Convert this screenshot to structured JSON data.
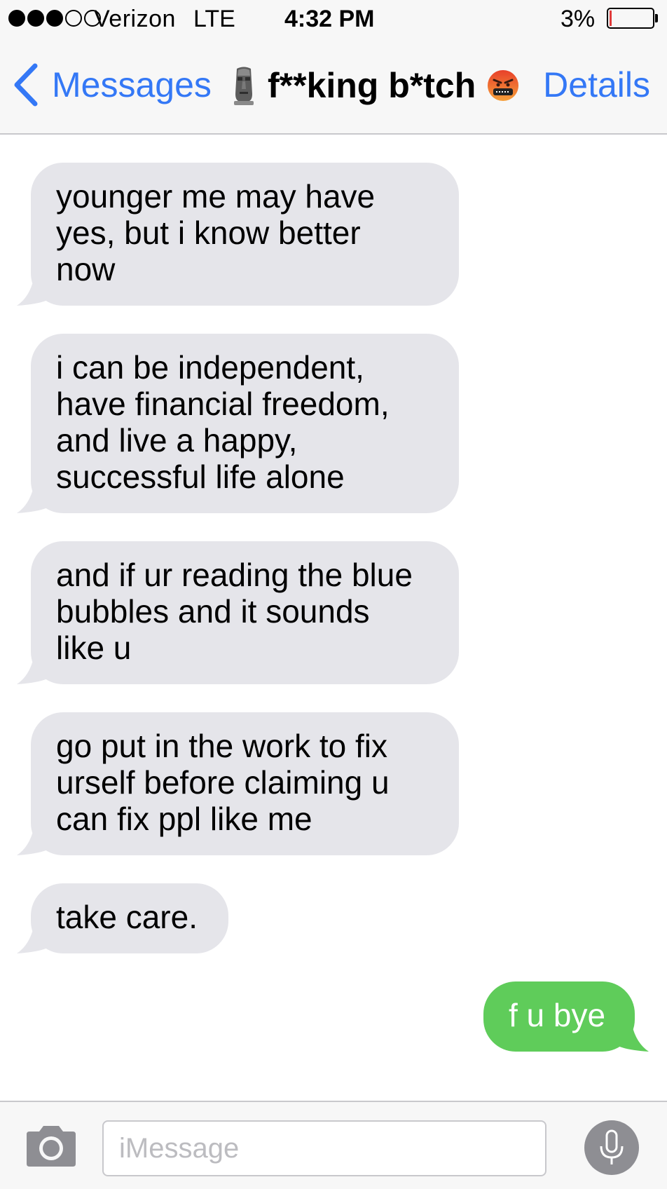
{
  "status_bar": {
    "carrier": "Verizon",
    "network": "LTE",
    "time": "4:32 PM",
    "battery_percent": "3%",
    "battery_level": 0.03,
    "signal_bars_filled": 3,
    "signal_bars_total": 5
  },
  "nav": {
    "back_label": "Messages",
    "title": "f**king b*tch",
    "title_prefix_icon": "moai-icon",
    "title_suffix_icon": "angry-face-icon",
    "details_label": "Details"
  },
  "messages": [
    {
      "direction": "incoming",
      "lines": [
        "younger me may have",
        "yes, but i know better",
        "now"
      ]
    },
    {
      "direction": "incoming",
      "lines": [
        "i can be independent,",
        "have financial freedom,",
        "and live a happy,",
        "successful life alone"
      ]
    },
    {
      "direction": "incoming",
      "lines": [
        "and if ur reading the blue",
        "bubbles and it sounds",
        "like u"
      ]
    },
    {
      "direction": "incoming",
      "lines": [
        "go put in the work to fix",
        "urself before claiming u",
        "can fix ppl like me"
      ]
    },
    {
      "direction": "incoming",
      "lines": [
        "take care."
      ]
    },
    {
      "direction": "outgoing",
      "lines": [
        "f u bye"
      ]
    }
  ],
  "input_bar": {
    "placeholder": "iMessage",
    "value": "",
    "camera_icon": "camera-icon",
    "mic_icon": "microphone-icon"
  },
  "colors": {
    "ios_blue": "#3478f6",
    "incoming_bubble": "#e5e5ea",
    "outgoing_bubble": "#5fcc5a",
    "bar_background": "#f7f7f7",
    "battery_low": "#e03a3a"
  }
}
